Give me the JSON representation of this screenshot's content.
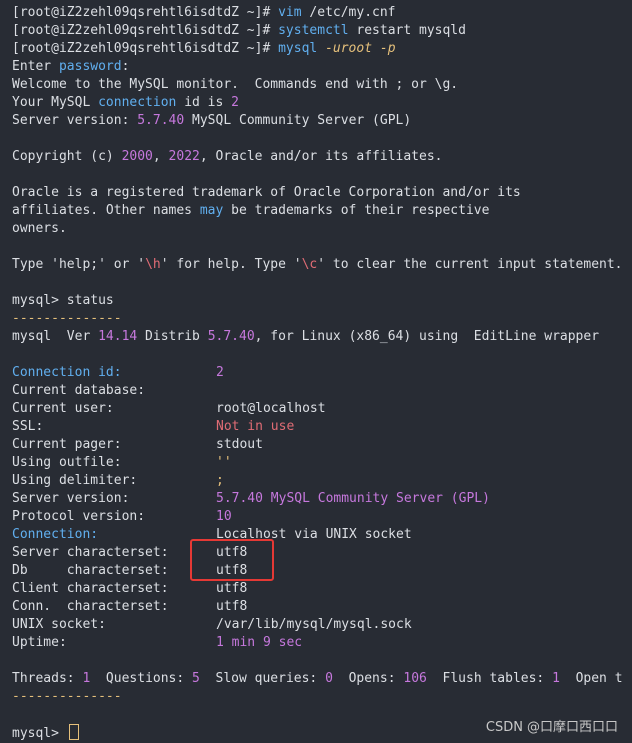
{
  "prompt_lines": [
    {
      "prompt": "[root@iZ2zehl09qsrehtl6isdtdZ ~]# ",
      "cmd_head": "vim",
      "cmd_tail": " /etc/my.cnf",
      "opt": ""
    },
    {
      "prompt": "[root@iZ2zehl09qsrehtl6isdtdZ ~]# ",
      "cmd_head": "systemctl",
      "cmd_tail": " restart mysqld",
      "opt": ""
    },
    {
      "prompt": "[root@iZ2zehl09qsrehtl6isdtdZ ~]# ",
      "cmd_head": "mysql",
      "cmd_tail": " ",
      "opt": "-uroot -p"
    }
  ],
  "login": {
    "enter": "Enter ",
    "password_word": "password",
    "colon": ":",
    "welcome": "Welcome to the MySQL monitor.  Commands end with ; or \\g.",
    "conn_pre": "Your MySQL ",
    "conn_word": "connection",
    "conn_mid": " id is ",
    "conn_id": "2",
    "server_pre": "Server version: ",
    "server_ver": "5.7.40",
    "server_post": " MySQL Community Server (GPL)"
  },
  "copyright": {
    "pre": "Copyright (c) ",
    "y1": "2000",
    "mid": ", ",
    "y2": "2022",
    "post": ", Oracle and/or its affiliates."
  },
  "trademark": {
    "line1": "Oracle is a registered trademark of Oracle Corporation and/or its",
    "line2_pre": "affiliates. Other names ",
    "line2_may": "may",
    "line2_post": " be trademarks of their respective",
    "line3": "owners."
  },
  "help": {
    "pre": "Type 'help;' or '",
    "h": "\\h",
    "mid": "' for help. Type '",
    "c": "\\c",
    "post": "' to clear the current input statement."
  },
  "status_cmd": {
    "prompt": "mysql> ",
    "command": "status"
  },
  "dashes": "--------------",
  "version_line": {
    "pre": "mysql  Ver ",
    "ver": "14.14",
    "mid": " Distrib ",
    "dist": "5.7.40",
    "post": ", for Linux (x86_64) using  EditLine wrapper"
  },
  "status": [
    {
      "label": "Connection id:",
      "value": "2"
    },
    {
      "label": "Current database:",
      "value": ""
    },
    {
      "label": "Current user:",
      "value": "root@localhost"
    },
    {
      "label": "SSL:",
      "value": "Not in use"
    },
    {
      "label": "Current pager:",
      "value": "stdout"
    },
    {
      "label": "Using outfile:",
      "value": "''"
    },
    {
      "label": "Using delimiter:",
      "value": ";"
    },
    {
      "label": "Server version:",
      "value": "5.7.40 MySQL Community Server (GPL)"
    },
    {
      "label": "Protocol version:",
      "value": "10"
    },
    {
      "label": "Connection:",
      "value": "Localhost via UNIX socket"
    },
    {
      "label": "Server characterset:",
      "value": "utf8"
    },
    {
      "label": "Db     characterset:",
      "value": "utf8"
    },
    {
      "label": "Client characterset:",
      "value": "utf8"
    },
    {
      "label": "Conn.  characterset:",
      "value": "utf8"
    },
    {
      "label": "UNIX socket:",
      "value": "/var/lib/mysql/mysql.sock"
    },
    {
      "label": "Uptime:",
      "value": "1 min 9 sec"
    }
  ],
  "threads_line": {
    "t_label": "Threads: ",
    "t_val": "1",
    "q_label": "  Questions: ",
    "q_val": "5",
    "s_label": "  Slow queries: ",
    "s_val": "0",
    "o_label": "  Opens: ",
    "o_val": "106",
    "f_label": "  Flush tables: ",
    "f_val": "1",
    "open_t": "  Open t"
  },
  "final_prompt": "mysql> ",
  "watermark": {
    "site": "CSDN",
    "handle": "@口摩口西口口"
  },
  "colors": {
    "background": "#282c34",
    "text": "#dcdfe4",
    "keyword": "#61afef",
    "number": "#c678dd",
    "warning": "#e06c75",
    "highlight_box": "#e53935"
  }
}
